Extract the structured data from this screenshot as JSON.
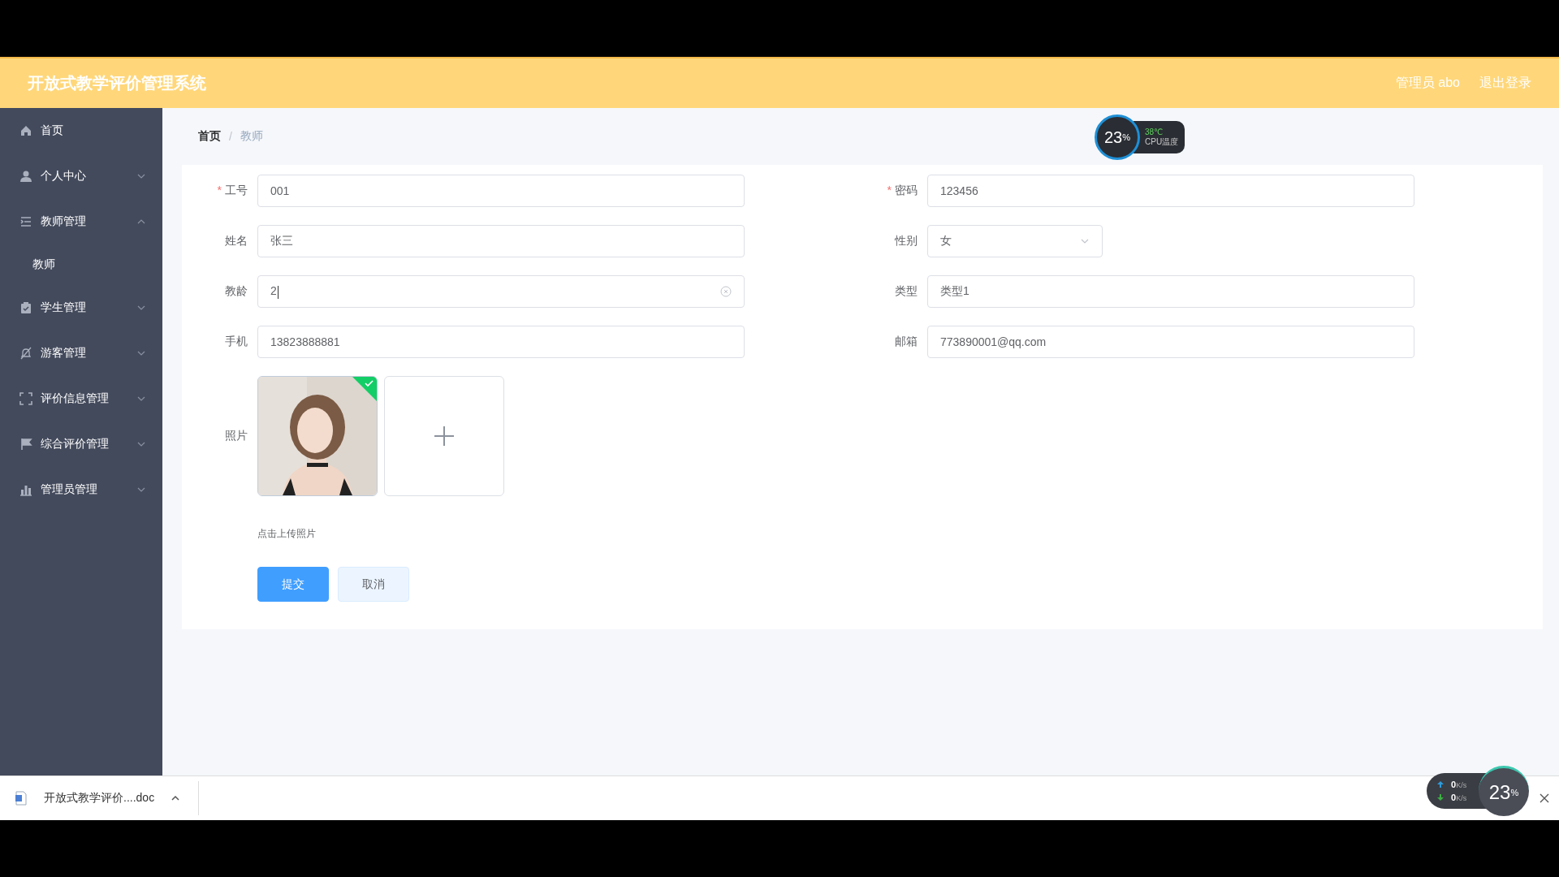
{
  "header": {
    "title": "开放式教学评价管理系统",
    "user": "管理员 abo",
    "logout": "退出登录"
  },
  "sidebar": {
    "items": [
      {
        "label": "首页",
        "kind": "link"
      },
      {
        "label": "个人中心",
        "kind": "group",
        "expanded": false
      },
      {
        "label": "教师管理",
        "kind": "group",
        "expanded": true,
        "children": [
          {
            "label": "教师"
          }
        ]
      },
      {
        "label": "学生管理",
        "kind": "group",
        "expanded": false
      },
      {
        "label": "游客管理",
        "kind": "group",
        "expanded": false
      },
      {
        "label": "评价信息管理",
        "kind": "group",
        "expanded": false
      },
      {
        "label": "综合评价管理",
        "kind": "group",
        "expanded": false
      },
      {
        "label": "管理员管理",
        "kind": "group",
        "expanded": false
      }
    ]
  },
  "breadcrumb": {
    "items": [
      "首页",
      "教师"
    ],
    "separator": "/"
  },
  "form": {
    "left": [
      {
        "label": "工号",
        "required_mark": "*",
        "kind": "text",
        "value": "001"
      },
      {
        "label": "姓名",
        "kind": "text",
        "value": "张三"
      },
      {
        "label": "教龄",
        "kind": "text",
        "value": "2",
        "clearable": true
      },
      {
        "label": "手机",
        "kind": "text",
        "value": "13823888881"
      }
    ],
    "right": [
      {
        "label": "密码",
        "required_mark": "*",
        "kind": "text",
        "value": "123456"
      },
      {
        "label": "性别",
        "kind": "select",
        "value": "女"
      },
      {
        "label": "类型",
        "kind": "text",
        "value": "类型1"
      },
      {
        "label": "邮箱",
        "kind": "text",
        "value": "773890001@qq.com"
      }
    ],
    "photo": {
      "label": "照片",
      "uploaded": true,
      "kind": "picture",
      "hint": "点击上传照片"
    },
    "buttons": [
      {
        "label": "提交",
        "kind": "primary"
      },
      {
        "label": "取消",
        "kind": "default"
      }
    ]
  },
  "download_bar": {
    "file": "开放式教学评价....doc"
  },
  "cpu_widget": {
    "usage": "23",
    "unit": "%",
    "temperature": "38℃",
    "label": "CPU温度"
  },
  "net_widget": {
    "upload": "0",
    "upload_unit": "K/s",
    "download": "0",
    "download_unit": "K/s",
    "usage": "23",
    "unit": "%"
  }
}
